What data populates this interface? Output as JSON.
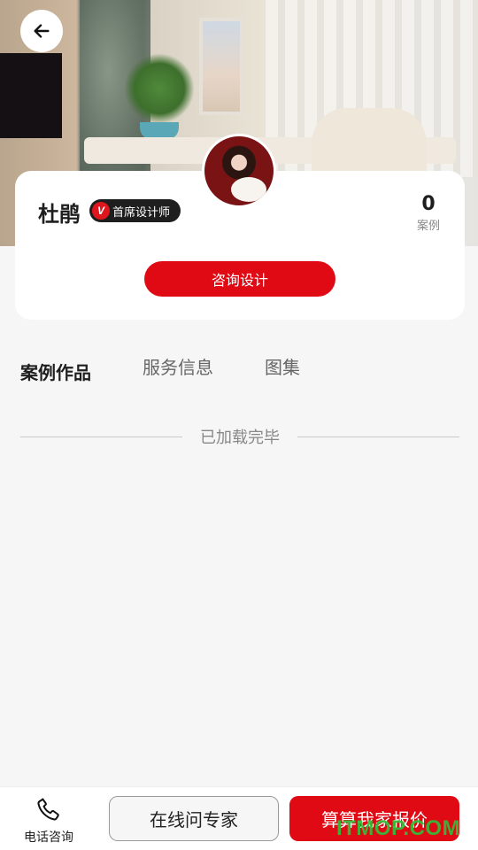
{
  "header": {
    "back_icon": "arrow-left-icon"
  },
  "profile": {
    "name": "杜鹃",
    "badge_letter": "V",
    "badge_label": "首席设计师",
    "stat_value": "0",
    "stat_label": "案例",
    "consult_label": "咨询设计"
  },
  "tabs": [
    {
      "label": "案例作品",
      "active": true
    },
    {
      "label": "服务信息",
      "active": false
    },
    {
      "label": "图集",
      "active": false
    }
  ],
  "list": {
    "end_text": "已加载完毕"
  },
  "bottom_bar": {
    "phone_icon": "phone-icon",
    "phone_label": "电话咨询",
    "ask_label": "在线问专家",
    "quote_label": "算算我家报价"
  },
  "watermark": "ITMOP.COM",
  "colors": {
    "accent": "#df0a14",
    "badge_bg": "#1e1e1e",
    "watermark": "#2fbf3a"
  }
}
